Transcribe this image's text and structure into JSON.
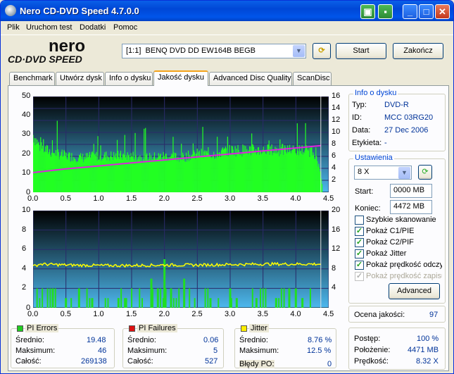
{
  "window": {
    "title": "Nero CD-DVD Speed 4.7.0.0"
  },
  "menu": [
    "Plik",
    "Uruchom test",
    "Dodatki",
    "Pomoc"
  ],
  "logo": {
    "line1": "nero",
    "line2": "CD·DVD SPEED"
  },
  "drive": {
    "id": "[1:1]",
    "name": "BENQ DVD DD EW164B BEGB"
  },
  "buttons": {
    "start": "Start",
    "stop": "Zakończ",
    "advanced": "Advanced"
  },
  "tabs": [
    "Benchmark",
    "Utwórz dysk",
    "Info o dysku",
    "Jakość dysku",
    "Advanced Disc Quality",
    "ScanDisc"
  ],
  "active_tab": "Jakość dysku",
  "disc_info": {
    "title": "Info o dysku",
    "type_label": "Typ:",
    "type": "DVD-R",
    "id_label": "ID:",
    "id": "MCC 03RG20",
    "date_label": "Data:",
    "date": "27 Dec 2006",
    "label_label": "Etykieta:",
    "label": "-"
  },
  "settings": {
    "title": "Ustawienia",
    "speed": "8 X",
    "start_label": "Start:",
    "start": "0000 MB",
    "end_label": "Koniec:",
    "end": "4472 MB",
    "options": [
      {
        "label": "Szybkie skanowanie",
        "checked": false,
        "enabled": true
      },
      {
        "label": "Pokaż C1/PIE",
        "checked": true,
        "enabled": true
      },
      {
        "label": "Pokaż C2/PIF",
        "checked": true,
        "enabled": true
      },
      {
        "label": "Pokaż Jitter",
        "checked": true,
        "enabled": true
      },
      {
        "label": "Pokaż prędkość odczytu",
        "checked": true,
        "enabled": true
      },
      {
        "label": "Pokaż prędkość zapisu",
        "checked": true,
        "enabled": false
      }
    ]
  },
  "quality": {
    "label": "Ocena jakości:",
    "value": "97"
  },
  "progress": {
    "progress_label": "Postęp:",
    "progress": "100 %",
    "position_label": "Położenie:",
    "position": "4471 MB",
    "speed_label": "Prędkość:",
    "speed": "8.32 X"
  },
  "stats": {
    "pi_errors": {
      "title": "PI Errors",
      "avg_label": "Średnio:",
      "avg": "19.48",
      "max_label": "Maksimum:",
      "max": "46",
      "total_label": "Całość:",
      "total": "269138",
      "color": "#22cc22"
    },
    "pi_failures": {
      "title": "PI Failures",
      "avg_label": "Średnio:",
      "avg": "0.06",
      "max_label": "Maksimum:",
      "max": "5",
      "total_label": "Całość:",
      "total": "527",
      "color": "#dd1111"
    },
    "jitter": {
      "title": "Jitter",
      "avg_label": "Średnio:",
      "avg": "8.76 %",
      "max_label": "Maksimum:",
      "max": "12.5 %",
      "po_label": "Błędy PO:",
      "po": "0",
      "color": "#ffee00"
    }
  },
  "colors": {
    "pie": "#22ff22",
    "pif": "#22dd22",
    "speed": "#dd22dd",
    "jitter": "#ffff00",
    "chart_bg_top": "#000000",
    "chart_bg_bottom": "#4db8ee"
  },
  "chart_data": [
    {
      "type": "area",
      "title": "",
      "x_ticks": [
        "0.0",
        "0.5",
        "1.0",
        "1.5",
        "2.0",
        "2.5",
        "3.0",
        "3.5",
        "4.0",
        "4.5"
      ],
      "xlim": [
        0,
        4.5
      ],
      "y_ticks_left": [
        "10",
        "20",
        "30",
        "40",
        "50"
      ],
      "ylim_left": [
        0,
        50
      ],
      "y_ticks_right": [
        "2",
        "4",
        "6",
        "8",
        "10",
        "12",
        "14",
        "16"
      ],
      "ylim_right": [
        0,
        16
      ],
      "series": [
        {
          "name": "PI Errors",
          "axis": "left",
          "x": [
            0.0,
            0.1,
            0.2,
            0.3,
            0.5,
            0.75,
            1.0,
            1.25,
            1.5,
            1.75,
            2.0,
            2.25,
            2.5,
            2.75,
            3.0,
            3.25,
            3.5,
            3.75,
            4.0,
            4.2,
            4.3,
            4.4
          ],
          "y": [
            30,
            24,
            22,
            21,
            19,
            18,
            19,
            19,
            19,
            18,
            19,
            18,
            20,
            20,
            22,
            22,
            22,
            22,
            22,
            22,
            20,
            5
          ]
        },
        {
          "name": "Read Speed",
          "axis": "right",
          "x": [
            0.0,
            0.5,
            1.0,
            1.5,
            2.0,
            2.5,
            3.0,
            3.5,
            4.0,
            4.38
          ],
          "y": [
            3.3,
            3.9,
            4.4,
            4.9,
            5.4,
            5.9,
            6.4,
            6.9,
            7.4,
            7.8
          ]
        }
      ]
    },
    {
      "type": "bar",
      "title": "",
      "x_ticks": [
        "0.0",
        "0.5",
        "1.0",
        "1.5",
        "2.0",
        "2.5",
        "3.0",
        "3.5",
        "4.0",
        "4.5"
      ],
      "xlim": [
        0,
        4.5
      ],
      "y_ticks_left": [
        "2",
        "4",
        "6",
        "8",
        "10"
      ],
      "ylim_left": [
        0,
        10
      ],
      "y_ticks_right": [
        "4",
        "8",
        "12",
        "16",
        "20"
      ],
      "ylim_right": [
        0,
        20
      ],
      "series": [
        {
          "name": "PI Failures",
          "axis": "left",
          "x": [
            0.3,
            0.5,
            0.7,
            0.9,
            1.3,
            1.4,
            1.8,
            1.9,
            2.0,
            2.1,
            2.3,
            2.7,
            3.0,
            3.1,
            3.4,
            3.7,
            3.9,
            4.0,
            4.1
          ],
          "y": [
            2,
            1,
            2,
            1,
            1,
            1,
            3,
            2,
            5,
            2,
            3,
            1,
            2,
            1,
            1,
            1,
            2,
            2,
            1
          ]
        },
        {
          "name": "Jitter",
          "axis": "right",
          "x": [
            0.0,
            0.1,
            0.5,
            1.0,
            1.5,
            2.0,
            2.5,
            3.0,
            3.5,
            4.0,
            4.38
          ],
          "y": [
            8.5,
            9.0,
            8.8,
            8.7,
            8.7,
            8.8,
            8.8,
            8.9,
            9.0,
            9.0,
            9.0
          ]
        }
      ]
    }
  ]
}
